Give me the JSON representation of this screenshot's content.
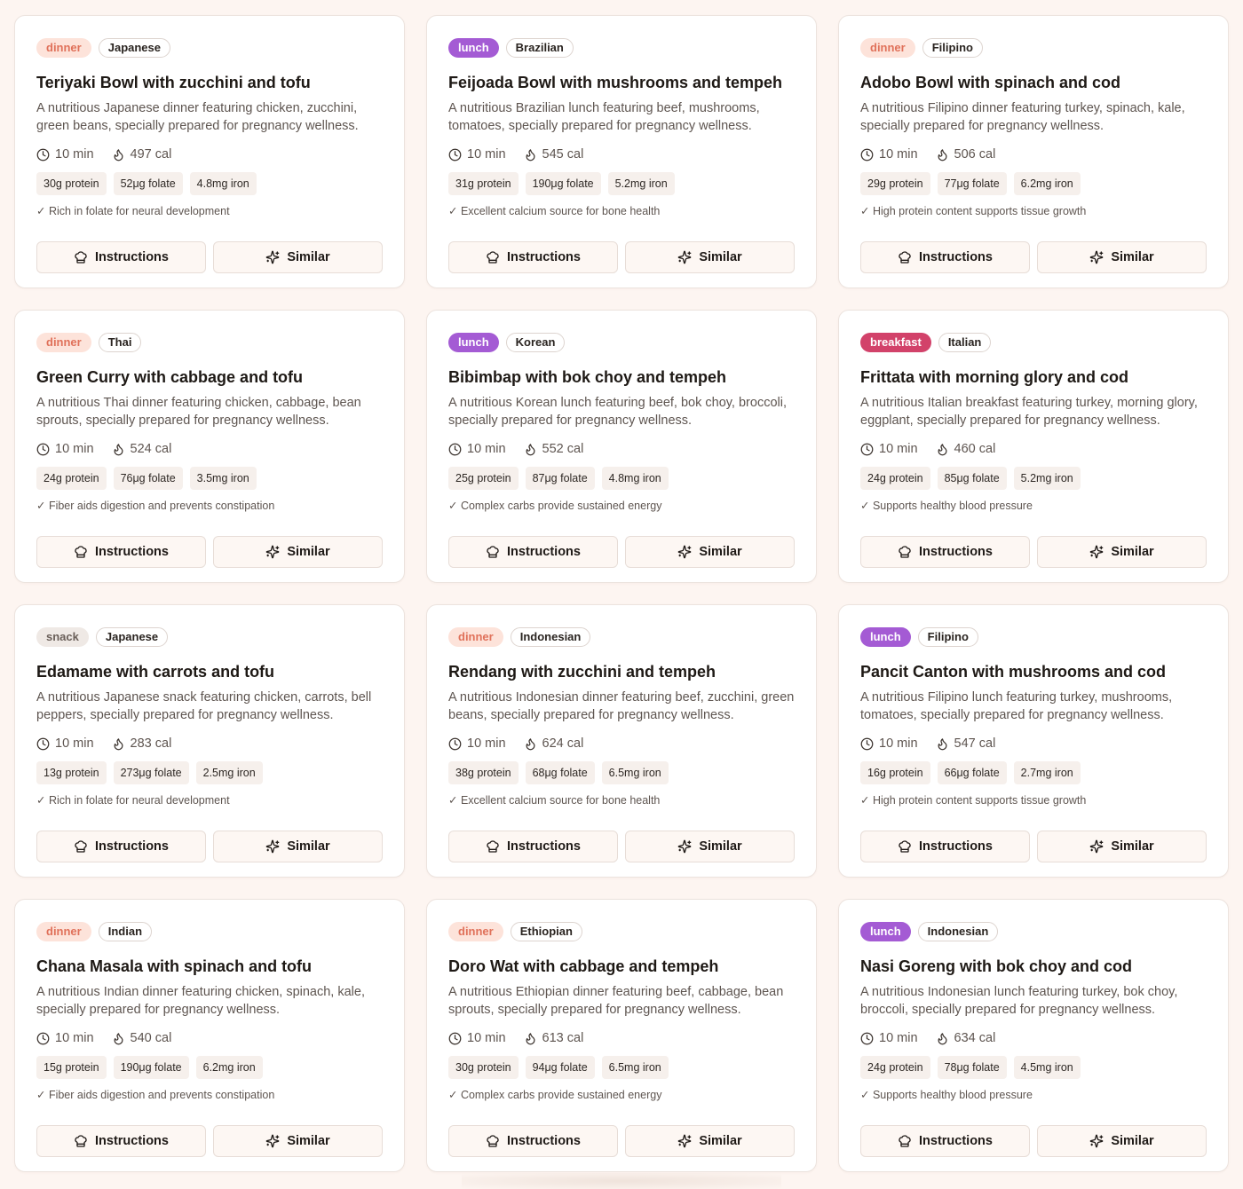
{
  "buttons": {
    "instructions_label": "Instructions",
    "similar_label": "Similar"
  },
  "colors": {
    "dinner_bg": "#fde3da",
    "dinner_text": "#e0715a",
    "lunch_bg": "#a45bd4",
    "breakfast_bg": "#d2426a",
    "snack_bg": "#efe9e5",
    "page_bg": "#fdf5f1"
  },
  "icons": {
    "time": "clock-icon",
    "calories": "flame-icon",
    "instructions": "chef-hat-icon",
    "similar": "sparkles-icon"
  },
  "recipes": [
    {
      "meal": "dinner",
      "cuisine": "Japanese",
      "title": "Teriyaki Bowl with zucchini and tofu",
      "description": "A nutritious Japanese dinner featuring chicken, zucchini, green beans, specially prepared for pregnancy wellness.",
      "time": "10 min",
      "calories": "497 cal",
      "protein": "30g protein",
      "folate": "52μg folate",
      "iron": "4.8mg iron",
      "benefit": "✓ Rich in folate for neural development"
    },
    {
      "meal": "lunch",
      "cuisine": "Brazilian",
      "title": "Feijoada Bowl with mushrooms and tempeh",
      "description": "A nutritious Brazilian lunch featuring beef, mushrooms, tomatoes, specially prepared for pregnancy wellness.",
      "time": "10 min",
      "calories": "545 cal",
      "protein": "31g protein",
      "folate": "190μg folate",
      "iron": "5.2mg iron",
      "benefit": "✓ Excellent calcium source for bone health"
    },
    {
      "meal": "dinner",
      "cuisine": "Filipino",
      "title": "Adobo Bowl with spinach and cod",
      "description": "A nutritious Filipino dinner featuring turkey, spinach, kale, specially prepared for pregnancy wellness.",
      "time": "10 min",
      "calories": "506 cal",
      "protein": "29g protein",
      "folate": "77μg folate",
      "iron": "6.2mg iron",
      "benefit": "✓ High protein content supports tissue growth"
    },
    {
      "meal": "dinner",
      "cuisine": "Thai",
      "title": "Green Curry with cabbage and tofu",
      "description": "A nutritious Thai dinner featuring chicken, cabbage, bean sprouts, specially prepared for pregnancy wellness.",
      "time": "10 min",
      "calories": "524 cal",
      "protein": "24g protein",
      "folate": "76μg folate",
      "iron": "3.5mg iron",
      "benefit": "✓ Fiber aids digestion and prevents constipation"
    },
    {
      "meal": "lunch",
      "cuisine": "Korean",
      "title": "Bibimbap with bok choy and tempeh",
      "description": "A nutritious Korean lunch featuring beef, bok choy, broccoli, specially prepared for pregnancy wellness.",
      "time": "10 min",
      "calories": "552 cal",
      "protein": "25g protein",
      "folate": "87μg folate",
      "iron": "4.8mg iron",
      "benefit": "✓ Complex carbs provide sustained energy"
    },
    {
      "meal": "breakfast",
      "cuisine": "Italian",
      "title": "Frittata with morning glory and cod",
      "description": "A nutritious Italian breakfast featuring turkey, morning glory, eggplant, specially prepared for pregnancy wellness.",
      "time": "10 min",
      "calories": "460 cal",
      "protein": "24g protein",
      "folate": "85μg folate",
      "iron": "5.2mg iron",
      "benefit": "✓ Supports healthy blood pressure"
    },
    {
      "meal": "snack",
      "cuisine": "Japanese",
      "title": "Edamame with carrots and tofu",
      "description": "A nutritious Japanese snack featuring chicken, carrots, bell peppers, specially prepared for pregnancy wellness.",
      "time": "10 min",
      "calories": "283 cal",
      "protein": "13g protein",
      "folate": "273μg folate",
      "iron": "2.5mg iron",
      "benefit": "✓ Rich in folate for neural development"
    },
    {
      "meal": "dinner",
      "cuisine": "Indonesian",
      "title": "Rendang with zucchini and tempeh",
      "description": "A nutritious Indonesian dinner featuring beef, zucchini, green beans, specially prepared for pregnancy wellness.",
      "time": "10 min",
      "calories": "624 cal",
      "protein": "38g protein",
      "folate": "68μg folate",
      "iron": "6.5mg iron",
      "benefit": "✓ Excellent calcium source for bone health"
    },
    {
      "meal": "lunch",
      "cuisine": "Filipino",
      "title": "Pancit Canton with mushrooms and cod",
      "description": "A nutritious Filipino lunch featuring turkey, mushrooms, tomatoes, specially prepared for pregnancy wellness.",
      "time": "10 min",
      "calories": "547 cal",
      "protein": "16g protein",
      "folate": "66μg folate",
      "iron": "2.7mg iron",
      "benefit": "✓ High protein content supports tissue growth"
    },
    {
      "meal": "dinner",
      "cuisine": "Indian",
      "title": "Chana Masala with spinach and tofu",
      "description": "A nutritious Indian dinner featuring chicken, spinach, kale, specially prepared for pregnancy wellness.",
      "time": "10 min",
      "calories": "540 cal",
      "protein": "15g protein",
      "folate": "190μg folate",
      "iron": "6.2mg iron",
      "benefit": "✓ Fiber aids digestion and prevents constipation"
    },
    {
      "meal": "dinner",
      "cuisine": "Ethiopian",
      "title": "Doro Wat with cabbage and tempeh",
      "description": "A nutritious Ethiopian dinner featuring beef, cabbage, bean sprouts, specially prepared for pregnancy wellness.",
      "time": "10 min",
      "calories": "613 cal",
      "protein": "30g protein",
      "folate": "94μg folate",
      "iron": "6.5mg iron",
      "benefit": "✓ Complex carbs provide sustained energy"
    },
    {
      "meal": "lunch",
      "cuisine": "Indonesian",
      "title": "Nasi Goreng with bok choy and cod",
      "description": "A nutritious Indonesian lunch featuring turkey, bok choy, broccoli, specially prepared for pregnancy wellness.",
      "time": "10 min",
      "calories": "634 cal",
      "protein": "24g protein",
      "folate": "78μg folate",
      "iron": "4.5mg iron",
      "benefit": "✓ Supports healthy blood pressure"
    }
  ]
}
